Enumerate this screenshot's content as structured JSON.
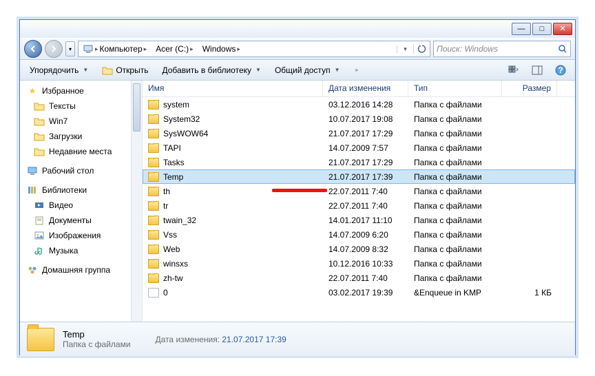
{
  "window": {
    "minimize": "—",
    "maximize": "□",
    "close": "✕"
  },
  "breadcrumb": {
    "root": "Компьютер",
    "drive": "Acer (C:)",
    "folder": "Windows"
  },
  "search": {
    "placeholder": "Поиск: Windows"
  },
  "toolbar": {
    "organize": "Упорядочить",
    "open": "Открыть",
    "add_library": "Добавить в библиотеку",
    "share": "Общий доступ"
  },
  "nav": {
    "favorites": "Избранное",
    "fav_items": [
      "Тексты",
      "Win7",
      "Загрузки",
      "Недавние места"
    ],
    "desktop": "Рабочий стол",
    "libraries": "Библиотеки",
    "lib_items": [
      "Видео",
      "Документы",
      "Изображения",
      "Музыка"
    ],
    "homegroup": "Домашняя группа"
  },
  "columns": {
    "name": "Имя",
    "date": "Дата изменения",
    "type": "Тип",
    "size": "Размер"
  },
  "files": [
    {
      "name": "system",
      "date": "03.12.2016 14:28",
      "type": "Папка с файлами",
      "size": "",
      "icon": "folder"
    },
    {
      "name": "System32",
      "date": "10.07.2017 19:08",
      "type": "Папка с файлами",
      "size": "",
      "icon": "folder"
    },
    {
      "name": "SysWOW64",
      "date": "21.07.2017 17:29",
      "type": "Папка с файлами",
      "size": "",
      "icon": "folder"
    },
    {
      "name": "TAPI",
      "date": "14.07.2009 7:57",
      "type": "Папка с файлами",
      "size": "",
      "icon": "folder"
    },
    {
      "name": "Tasks",
      "date": "21.07.2017 17:29",
      "type": "Папка с файлами",
      "size": "",
      "icon": "folder"
    },
    {
      "name": "Temp",
      "date": "21.07.2017 17:39",
      "type": "Папка с файлами",
      "size": "",
      "icon": "folder",
      "selected": true
    },
    {
      "name": "th",
      "date": "22.07.2011 7:40",
      "type": "Папка с файлами",
      "size": "",
      "icon": "folder"
    },
    {
      "name": "tr",
      "date": "22.07.2011 7:40",
      "type": "Папка с файлами",
      "size": "",
      "icon": "folder"
    },
    {
      "name": "twain_32",
      "date": "14.01.2017 11:10",
      "type": "Папка с файлами",
      "size": "",
      "icon": "folder"
    },
    {
      "name": "Vss",
      "date": "14.07.2009 6:20",
      "type": "Папка с файлами",
      "size": "",
      "icon": "folder"
    },
    {
      "name": "Web",
      "date": "14.07.2009 8:32",
      "type": "Папка с файлами",
      "size": "",
      "icon": "folder"
    },
    {
      "name": "winsxs",
      "date": "10.12.2016 10:33",
      "type": "Папка с файлами",
      "size": "",
      "icon": "folder"
    },
    {
      "name": "zh-tw",
      "date": "22.07.2011 7:40",
      "type": "Папка с файлами",
      "size": "",
      "icon": "folder"
    },
    {
      "name": "0",
      "date": "03.02.2017 19:39",
      "type": "&Enqueue in KMP",
      "size": "1 КБ",
      "icon": "file"
    }
  ],
  "details": {
    "name": "Temp",
    "type": "Папка с файлами",
    "date_label": "Дата изменения:",
    "date_value": "21.07.2017 17:39"
  }
}
